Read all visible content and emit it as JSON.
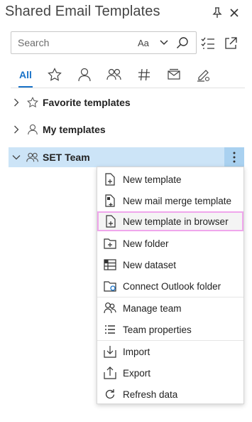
{
  "header": {
    "title": "Shared Email Templates",
    "pin_icon": "pin-icon",
    "close_icon": "close-icon"
  },
  "search": {
    "placeholder": "Search",
    "match_case_label": "Aa"
  },
  "tabs": [
    {
      "label": "All",
      "active": true
    },
    {
      "icon": "star-icon"
    },
    {
      "icon": "person-icon"
    },
    {
      "icon": "people-icon"
    },
    {
      "icon": "hashtag-icon"
    },
    {
      "icon": "mail-icon"
    },
    {
      "icon": "edit-icon"
    }
  ],
  "tree": {
    "favorites": "Favorite templates",
    "mine": "My templates",
    "team": "SET Team"
  },
  "menu": {
    "new_template": "New template",
    "new_mail_merge": "New mail merge template",
    "new_in_browser": "New template in browser",
    "new_folder": "New folder",
    "new_dataset": "New dataset",
    "connect_outlook": "Connect Outlook folder",
    "manage_team": "Manage team",
    "team_properties": "Team properties",
    "import": "Import",
    "export": "Export",
    "refresh": "Refresh data"
  },
  "colors": {
    "accent": "#1a73c8",
    "selected_row": "#cce4f7",
    "more_button": "#a9d1f0",
    "highlight_border": "#f0a6ec"
  }
}
